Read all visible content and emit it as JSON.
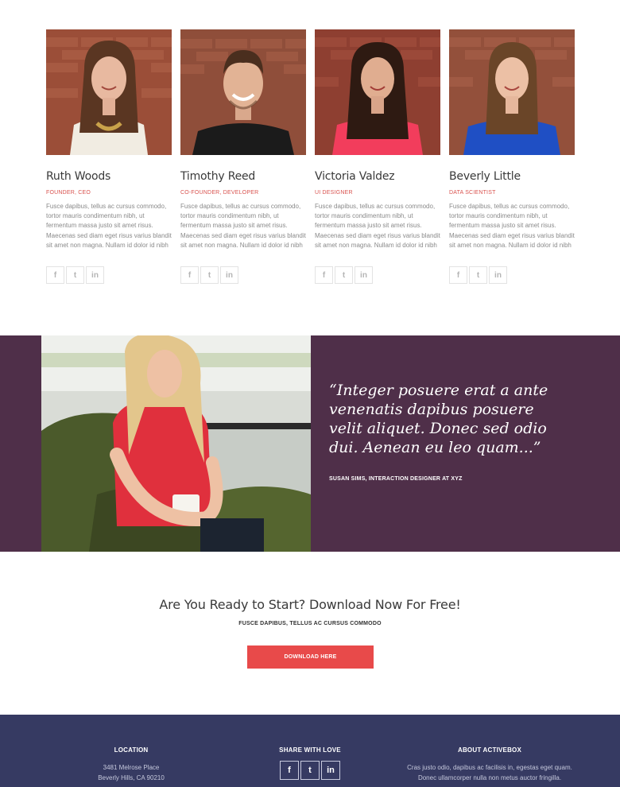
{
  "team": {
    "members": [
      {
        "name": "Ruth Woods",
        "role": "FOUNDER, CEO",
        "bio": "Fusce dapibus, tellus ac cursus commodo, tortor mauris condimentum nibh, ut fermentum massa justo sit amet risus. Maecenas sed diam eget risus varius blandit sit amet non magna. Nullam id dolor id nibh ultricies vehicula ut id elit."
      },
      {
        "name": "Timothy Reed",
        "role": "CO-FOUNDER, DEVELOPER",
        "bio": "Fusce dapibus, tellus ac cursus commodo, tortor mauris condimentum nibh, ut fermentum massa justo sit amet risus. Maecenas sed diam eget risus varius blandit sit amet non magna. Nullam id dolor id nibh ultricies vehicula ut id elit."
      },
      {
        "name": "Victoria Valdez",
        "role": "UI DESIGNER",
        "bio": "Fusce dapibus, tellus ac cursus commodo, tortor mauris condimentum nibh, ut fermentum massa justo sit amet risus. Maecenas sed diam eget risus varius blandit sit amet non magna. Nullam id dolor id nibh ultricies vehicula ut id elit."
      },
      {
        "name": "Beverly Little",
        "role": "DATA SCIENTIST",
        "bio": "Fusce dapibus, tellus ac cursus commodo, tortor mauris condimentum nibh, ut fermentum massa justo sit amet risus. Maecenas sed diam eget risus varius blandit sit amet non magna. Nullam id dolor id nibh ultricies vehicula ut id elit."
      }
    ],
    "social_icons": [
      "facebook-icon",
      "twitter-icon",
      "linkedin-icon"
    ],
    "social_glyphs": {
      "facebook": "f",
      "twitter": "t",
      "linkedin": "in"
    }
  },
  "testimonial": {
    "quote": "“Integer posuere erat a ante venenatis dapibus posuere velit aliquet. Donec sed odio dui. Aenean eu leo quam...”",
    "author": "SUSAN SIMS, INTERACTION DESIGNER AT XYZ",
    "bg_color": "#4f2f49"
  },
  "cta": {
    "title": "Are You Ready to Start? Download Now For Free!",
    "subtitle": "FUSCE DAPIBUS, TELLUS AC CURSUS COMMODO",
    "button_label": "DOWNLOAD HERE",
    "button_color": "#e84a4a"
  },
  "footer": {
    "bg_color": "#363a62",
    "location": {
      "heading": "LOCATION",
      "line1": "3481 Melrose Place",
      "line2": "Beverly Hills, CA 90210"
    },
    "share": {
      "heading": "SHARE WITH LOVE",
      "icons": [
        "facebook-icon",
        "twitter-icon",
        "linkedin-icon"
      ]
    },
    "about": {
      "heading": "ABOUT ACTIVEBOX",
      "text": "Cras justo odio, dapibus ac facilisis in, egestas eget quam. Donec ullamcorper nulla non metus auctor fringilla."
    }
  }
}
